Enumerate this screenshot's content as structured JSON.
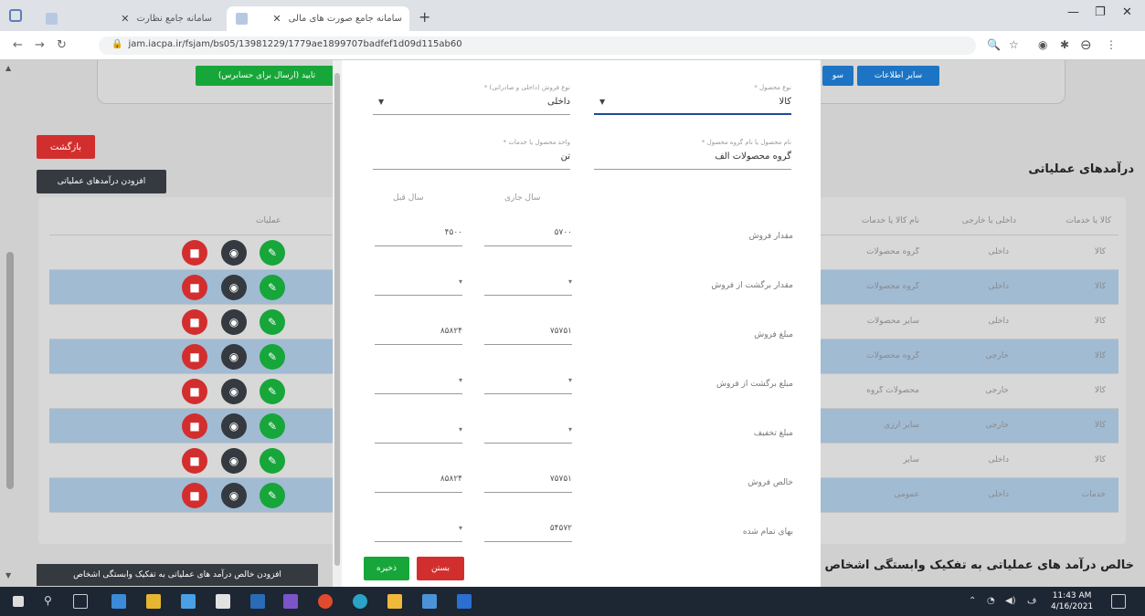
{
  "browser": {
    "tabs": [
      {
        "title": "سامانه جامع نظارت"
      },
      {
        "title": "سامانه جامع صورت های مالی",
        "active": true
      }
    ],
    "url": "jam.iacpa.ir/fsjam/bs05/13981229/1779ae1899707badfef1d09d115ab60"
  },
  "page": {
    "top_buttons": {
      "confirm_send": "تایید (ارسال برای حسابرس)",
      "other_info": "سایر اطلاعات",
      "partial": "سو"
    },
    "return_button": "بازگشت",
    "add_button": "افزودن درآمدهای عملیاتی",
    "section_title": "درآمدهای عملیاتی",
    "table": {
      "headers": [
        "کالا یا خدمات",
        "داخلی یا خارجی",
        "نام کالا یا خدمات",
        "عملیات"
      ],
      "rows": [
        {
          "type": "کالا",
          "origin": "داخلی",
          "name": "گروه محصولات",
          "highlight": false
        },
        {
          "type": "کالا",
          "origin": "داخلی",
          "name": "گروه محصولات",
          "highlight": true
        },
        {
          "type": "کالا",
          "origin": "داخلی",
          "name": "سایر محصولات",
          "highlight": false
        },
        {
          "type": "کالا",
          "origin": "خارجی",
          "name": "گروه محصولات",
          "highlight": true
        },
        {
          "type": "کالا",
          "origin": "خارجی",
          "name": "محصولات گروه",
          "highlight": false
        },
        {
          "type": "کالا",
          "origin": "خارجی",
          "name": "سایر ارزی",
          "highlight": true
        },
        {
          "type": "کالا",
          "origin": "داخلی",
          "name": "سایر",
          "highlight": false
        },
        {
          "type": "خدمات",
          "origin": "داخلی",
          "name": "عمومی",
          "highlight": true
        }
      ]
    },
    "bottom_title": "خالص درآمد های عملیاتی به تفکیک وابستگی اشخاص",
    "bottom_button": "افزودن خالص درآمد های عملیاتی به تفکیک وابستگی اشخاص"
  },
  "modal": {
    "product_type": {
      "label": "نوع محصول *",
      "value": "کالا"
    },
    "sales_type": {
      "label": "نوع فروش (داخلی و صادراتی) *",
      "value": "داخلی"
    },
    "product_name": {
      "label": "نام محصول یا نام گروه محصول *",
      "value": "گروه محصولات الف"
    },
    "unit": {
      "label": "واحد محصول یا خدمات *",
      "value": "تن"
    },
    "col_current": "سال جاری",
    "col_previous": "سال قبل",
    "rows": [
      {
        "label": "مقدار فروش",
        "current": "۵۷۰۰",
        "previous": "۴۵۰۰"
      },
      {
        "label": "مقدار برگشت از فروش",
        "current": "",
        "previous": ""
      },
      {
        "label": "مبلغ فروش",
        "current": "۷۵۷۵۱",
        "previous": "۸۵۸۲۴"
      },
      {
        "label": "مبلغ برگشت از فروش",
        "current": "",
        "previous": ""
      },
      {
        "label": "مبلغ تخفیف",
        "current": "",
        "previous": ""
      },
      {
        "label": "خالص فروش",
        "current": "۷۵۷۵۱",
        "previous": "۸۵۸۲۴"
      },
      {
        "label": "بهای تمام شده",
        "current": "۵۴۵۷۲",
        "previous": ""
      }
    ],
    "save_button": "ذخیره",
    "close_button": "بستن"
  },
  "taskbar": {
    "time": "11:43 AM",
    "date": "4/16/2021"
  },
  "colors": {
    "green": "#17a63a",
    "red": "#d32e2e",
    "dark": "#343a40",
    "blue": "#1d74c4",
    "row_highlight": "#a1bbd3"
  }
}
